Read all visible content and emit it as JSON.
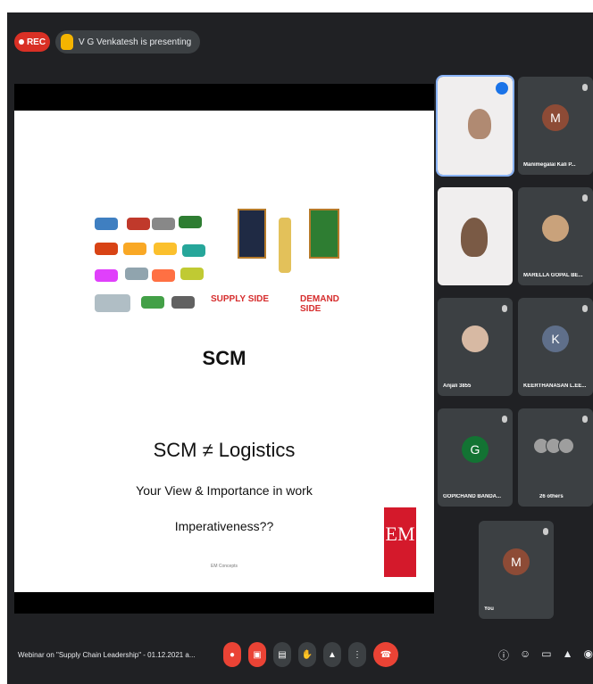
{
  "topbar": {
    "rec_label": "REC",
    "presenter_text": "V G Venkatesh is presenting"
  },
  "slide": {
    "supply_label": "SUPPLY SIDE",
    "demand_label": "DEMAND SIDE",
    "scm_title": "SCM",
    "equation": "SCM ≠ Logistics",
    "line1": "Your View & Importance in work",
    "line2": "Imperativeness??",
    "logo_text": "EM",
    "footer_text": "EM Concepts"
  },
  "participants": [
    {
      "name": "",
      "type": "camera"
    },
    {
      "name": "Manimegalai Kali P...",
      "initial": "M",
      "color": "#8d4b36"
    },
    {
      "name": "",
      "type": "camera"
    },
    {
      "name": "MARELLA GOPAL BE...",
      "type": "photo"
    },
    {
      "name": "Anjali 3855",
      "type": "photo"
    },
    {
      "name": "KEERTHANASAN L.EE...",
      "initial": "K",
      "color": "#5f6f8a"
    },
    {
      "name": "GOPICHAND BANDA...",
      "initial": "G",
      "color": "#137333"
    },
    {
      "name": "26 others",
      "type": "group"
    },
    {
      "name": "You",
      "initial": "M",
      "color": "#8d4b36"
    }
  ],
  "bottombar": {
    "meeting_title": "Webinar on \"Supply Chain Leadership\" - 01.12.2021 a...",
    "controls": [
      "mic-off",
      "camera-off",
      "captions",
      "raise-hand",
      "present",
      "more",
      "end-call"
    ],
    "right_controls": [
      "info",
      "people",
      "chat",
      "activities",
      "security"
    ]
  }
}
